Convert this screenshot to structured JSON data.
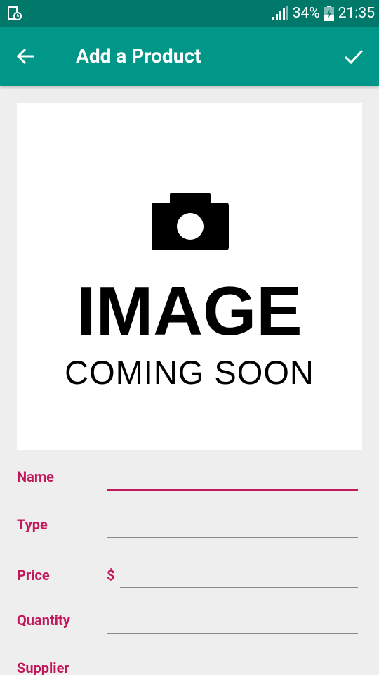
{
  "status_bar": {
    "battery": "34%",
    "time": "21:35",
    "left_icon": "screenshot-notification-icon",
    "signal_icon": "signal-icon",
    "battery_icon": "battery-charging-icon"
  },
  "app_bar": {
    "title": "Add a Product",
    "back_icon": "arrow-back-icon",
    "save_icon": "check-icon",
    "color": "#009688"
  },
  "product_image": {
    "line1": "IMAGE",
    "line2": "COMING SOON",
    "icon": "camera-icon"
  },
  "form": {
    "name": {
      "label": "Name",
      "value": ""
    },
    "type": {
      "label": "Type",
      "value": ""
    },
    "price": {
      "label": "Price",
      "currency": "$",
      "value": ""
    },
    "quantity": {
      "label": "Quantity",
      "value": ""
    },
    "supplier": {
      "label": "Supplier"
    }
  },
  "colors": {
    "accent": "#c2185b",
    "primary_dark": "#00796b"
  }
}
